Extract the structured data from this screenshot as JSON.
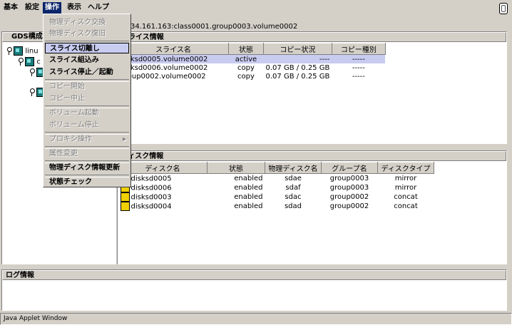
{
  "menubar": {
    "items": [
      "基本",
      "設定",
      "操作",
      "表示",
      "ヘルプ"
    ]
  },
  "dropdown": {
    "items": [
      {
        "label": "物理ディスク交換",
        "enabled": false
      },
      {
        "label": "物理ディスク復旧",
        "enabled": false
      },
      {
        "label": "スライス切離し",
        "enabled": true,
        "selected": true
      },
      {
        "label": "スライス組込み",
        "enabled": true
      },
      {
        "label": "スライス停止／起動",
        "enabled": true
      },
      {
        "label": "コピー開始",
        "enabled": false
      },
      {
        "label": "コピー中止",
        "enabled": false
      },
      {
        "label": "ボリューム起動",
        "enabled": false
      },
      {
        "label": "ボリューム停止",
        "enabled": false
      },
      {
        "label": "プロキシ操作",
        "enabled": false,
        "submenu": true
      },
      {
        "label": "属性変更",
        "enabled": false
      },
      {
        "label": "物理ディスク情報更新",
        "enabled": true
      },
      {
        "label": "状態チェック",
        "enabled": true
      }
    ],
    "submenu_arrow": "▸"
  },
  "path_label": "34.161.163:class0001.group0003.volume0002",
  "tree": {
    "title": "GDS構成ツ",
    "root_label": "linu",
    "child_label": "c"
  },
  "slice_panel": {
    "title": "スライス情報",
    "columns": [
      "スライス名",
      "状態",
      "コピー状況",
      "コピー種別"
    ],
    "rows": [
      [
        "disksd0005.volume0002",
        "active",
        "----",
        "-----"
      ],
      [
        "disksd0006.volume0002",
        "copy",
        "0.07 GB / 0.25 GB",
        "-----"
      ],
      [
        "group0002.volume0002",
        "copy",
        "0.07 GB / 0.25 GB",
        "-----"
      ]
    ]
  },
  "disk_panel": {
    "title": "ディスク情報",
    "columns": [
      "ディスク名",
      "状態",
      "物理ディスク名",
      "グループ名",
      "ディスクタイプ"
    ],
    "rows": [
      [
        "disksd0005",
        "enabled",
        "sdae",
        "group0003",
        "mirror"
      ],
      [
        "disksd0006",
        "enabled",
        "sdaf",
        "group0003",
        "mirror"
      ],
      [
        "disksd0003",
        "enabled",
        "sdac",
        "group0002",
        "concat"
      ],
      [
        "disksd0004",
        "enabled",
        "sdad",
        "group0002",
        "concat"
      ]
    ]
  },
  "log_panel": {
    "title": "ログ情報"
  },
  "status_bar": {
    "text": "Java Applet Window"
  },
  "colors": {
    "window_bg": "#d4d0c8",
    "menu_highlight": "#0a246a",
    "selected_row": "#c8ccf0"
  }
}
